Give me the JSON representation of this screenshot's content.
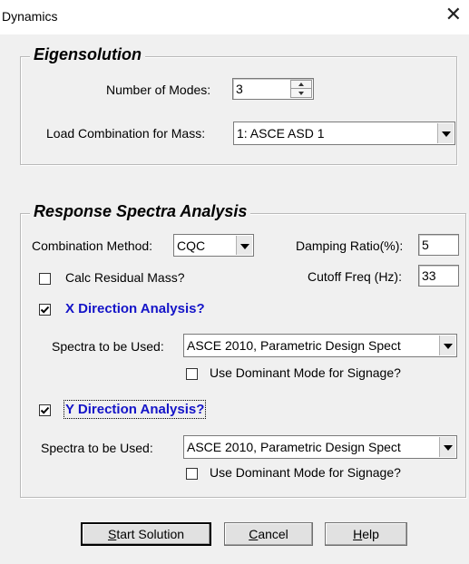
{
  "window": {
    "title": "Dynamics",
    "close_glyph": "✕"
  },
  "eigen": {
    "title": "Eigensolution",
    "num_modes_label": "Number of Modes:",
    "num_modes_value": "3",
    "load_combo_label": "Load Combination for Mass:",
    "load_combo_value": "1: ASCE ASD 1"
  },
  "rsa": {
    "title": "Response Spectra Analysis",
    "combination_label": "Combination Method:",
    "combination_value": "CQC",
    "damping_label": "Damping Ratio(%):",
    "damping_value": "5",
    "calc_residual_label": "Calc Residual Mass?",
    "calc_residual_checked": false,
    "cutoff_label": "Cutoff Freq (Hz):",
    "cutoff_value": "33",
    "x": {
      "label": "X Direction Analysis?",
      "checked": true,
      "spectra_label": "Spectra to be Used:",
      "spectra_value": "ASCE 2010, Parametric Design Spect",
      "dominant_label": "Use Dominant Mode for Signage?",
      "dominant_checked": false
    },
    "y": {
      "label": "Y Direction Analysis?",
      "checked": true,
      "spectra_label": "Spectra to be Used:",
      "spectra_value": "ASCE 2010, Parametric Design Spect",
      "dominant_label": "Use Dominant Mode for Signage?",
      "dominant_checked": false
    }
  },
  "buttons": {
    "start_first": "S",
    "start_rest": "tart Solution",
    "cancel_first": "C",
    "cancel_rest": "ancel",
    "help_first": "H",
    "help_rest": "elp"
  },
  "icons": {
    "close": "close-icon",
    "spin_up": "spin-up-icon",
    "spin_down": "spin-down-icon",
    "dropdown": "chevron-down-icon",
    "check": "checkmark-icon"
  }
}
